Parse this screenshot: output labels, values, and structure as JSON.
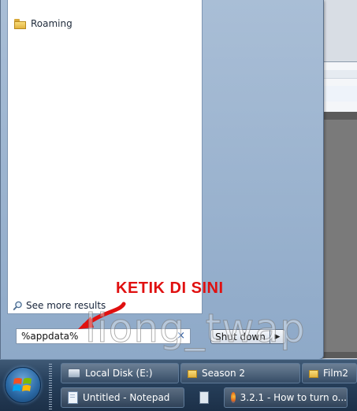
{
  "start_menu": {
    "results": [
      {
        "label": "Roaming",
        "icon": "folder-icon"
      }
    ],
    "see_more": "See more results",
    "search_value": "%appdata%",
    "clear_symbol": "×",
    "shutdown_label": "Shut down",
    "shutdown_arrow": "▶"
  },
  "annotation": {
    "text": "KETIK DI SINI",
    "color": "#e01010"
  },
  "watermark": "liong_twap",
  "taskbar": {
    "row1": [
      {
        "label": "Local Disk (E:)",
        "icon": "drive-icon"
      },
      {
        "label": "Season 2",
        "icon": "folder-icon"
      },
      {
        "label": "Film2",
        "icon": "folder-icon"
      }
    ],
    "row2": [
      {
        "label": "Untitled - Notepad",
        "icon": "notepad-icon"
      },
      {
        "label": "3.2.1 - How to turn o...",
        "icon": "firefox-icon"
      }
    ]
  }
}
